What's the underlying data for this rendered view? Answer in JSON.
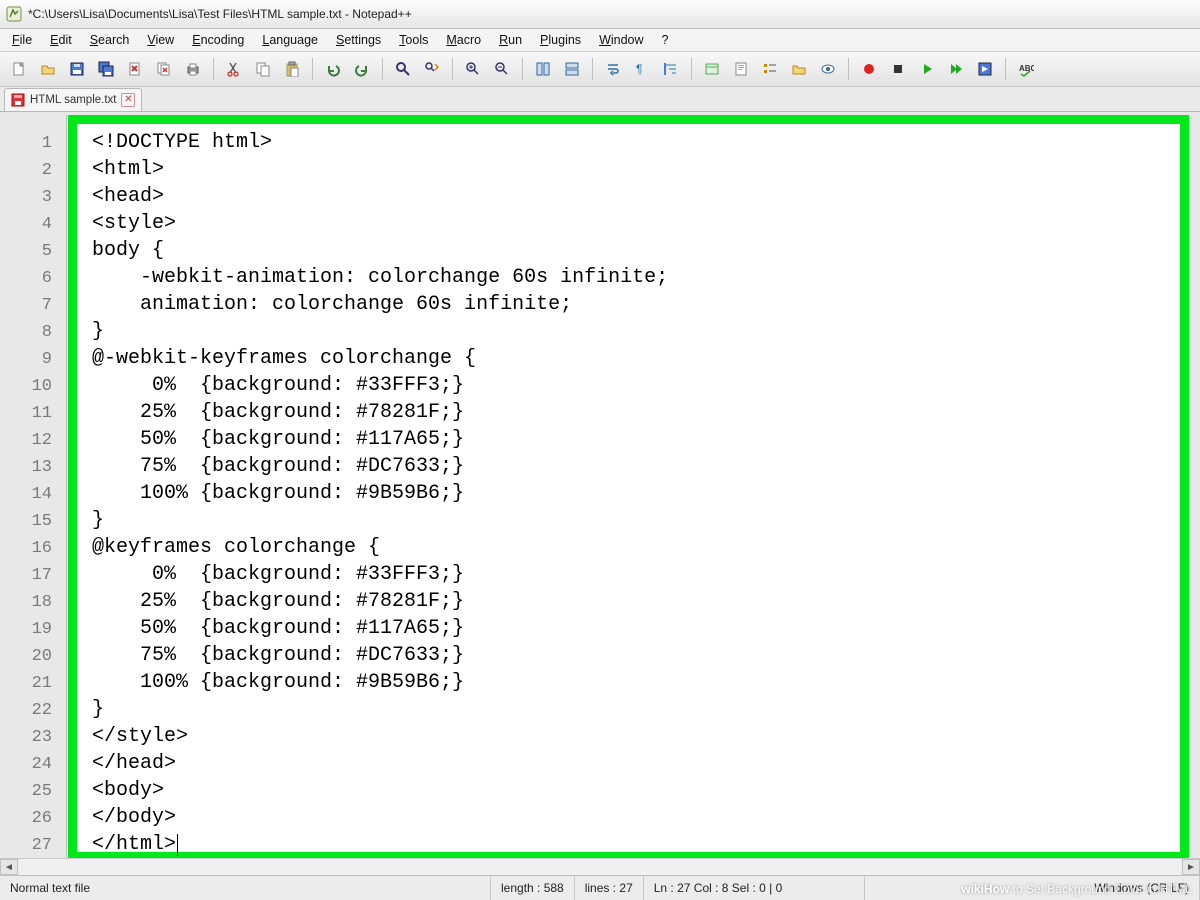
{
  "window": {
    "title": "*C:\\Users\\Lisa\\Documents\\Lisa\\Test Files\\HTML sample.txt - Notepad++"
  },
  "menu": {
    "items": [
      "File",
      "Edit",
      "Search",
      "View",
      "Encoding",
      "Language",
      "Settings",
      "Tools",
      "Macro",
      "Run",
      "Plugins",
      "Window",
      "?"
    ]
  },
  "toolbar": {
    "icons": [
      "new-file-icon",
      "open-file-icon",
      "save-icon",
      "save-all-icon",
      "close-icon",
      "close-all-icon",
      "print-icon",
      "sep",
      "cut-icon",
      "copy-icon",
      "paste-icon",
      "sep",
      "undo-icon",
      "redo-icon",
      "sep",
      "find-icon",
      "replace-icon",
      "sep",
      "zoom-in-icon",
      "zoom-out-icon",
      "sep",
      "sync-v-icon",
      "sync-h-icon",
      "sep",
      "wrap-icon",
      "invisible-icon",
      "indent-guide-icon",
      "sep",
      "lang-icon",
      "doc-map-icon",
      "func-list-icon",
      "folder-icon",
      "monitor-icon",
      "sep",
      "record-icon",
      "stop-icon",
      "play-icon",
      "play-multi-icon",
      "save-macro-icon",
      "sep",
      "spellcheck-icon"
    ]
  },
  "tab": {
    "label": "HTML sample.txt",
    "dirty": true
  },
  "code_lines": [
    "<!DOCTYPE html>",
    "<html>",
    "<head>",
    "<style>",
    "body {",
    "    -webkit-animation: colorchange 60s infinite;",
    "    animation: colorchange 60s infinite;",
    "}",
    "@-webkit-keyframes colorchange {",
    "     0%  {background: #33FFF3;}",
    "    25%  {background: #78281F;}",
    "    50%  {background: #117A65;}",
    "    75%  {background: #DC7633;}",
    "    100% {background: #9B59B6;}",
    "}",
    "@keyframes colorchange {",
    "     0%  {background: #33FFF3;}",
    "    25%  {background: #78281F;}",
    "    50%  {background: #117A65;}",
    "    75%  {background: #DC7633;}",
    "    100% {background: #9B59B6;}",
    "}",
    "</style>",
    "</head>",
    "<body>",
    "</body>",
    "</html>"
  ],
  "status": {
    "filetype": "Normal text file",
    "length_label": "length : 588",
    "lines_label": "lines : 27",
    "pos_label": "Ln : 27   Col : 8   Sel : 0 | 0",
    "eol": "Windows (CR LF)"
  },
  "watermark": {
    "brand": "wikiHow",
    "caption": " to Set Background Color in HTML"
  }
}
